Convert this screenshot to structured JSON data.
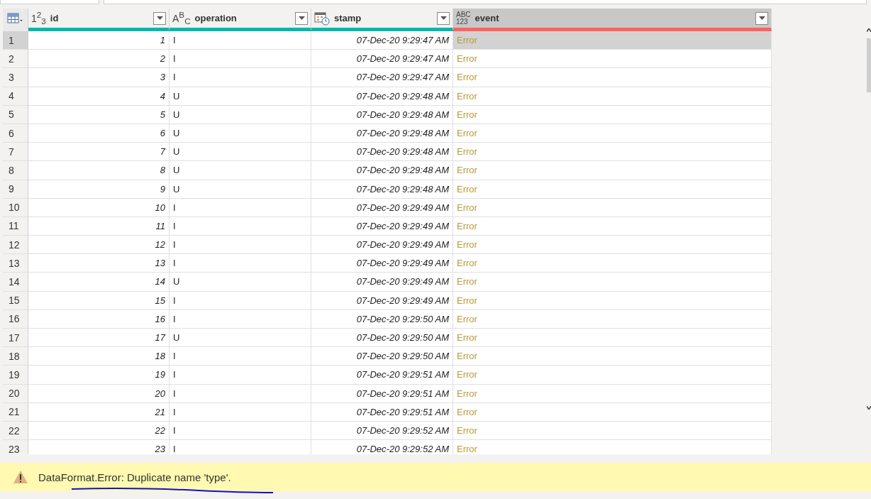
{
  "table": {
    "columns": [
      {
        "name": "id",
        "kind": "number",
        "glyph": [
          "1$^{2}$$_{3}$"
        ],
        "color": "#01b8aa",
        "selected": false
      },
      {
        "name": "operation",
        "kind": "text",
        "glyph": [
          "A$^{B}$$_{C}$"
        ],
        "color": "#01b8aa",
        "selected": false
      },
      {
        "name": "stamp",
        "kind": "datetime",
        "color": "#01b8aa",
        "selected": false
      },
      {
        "name": "event",
        "kind": "any",
        "glyph": [
          "ABC",
          "123"
        ],
        "color": "#fd625e",
        "selected": true
      }
    ],
    "rows": [
      {
        "n": "1",
        "cells": [
          "1",
          "I",
          "07-Dec-20 9:29:47 AM",
          "Error"
        ],
        "selected": true
      },
      {
        "n": "2",
        "cells": [
          "2",
          "I",
          "07-Dec-20 9:29:47 AM",
          "Error"
        ],
        "selected": false
      },
      {
        "n": "3",
        "cells": [
          "3",
          "I",
          "07-Dec-20 9:29:47 AM",
          "Error"
        ],
        "selected": false
      },
      {
        "n": "4",
        "cells": [
          "4",
          "U",
          "07-Dec-20 9:29:48 AM",
          "Error"
        ],
        "selected": false
      },
      {
        "n": "5",
        "cells": [
          "5",
          "U",
          "07-Dec-20 9:29:48 AM",
          "Error"
        ],
        "selected": false
      },
      {
        "n": "6",
        "cells": [
          "6",
          "U",
          "07-Dec-20 9:29:48 AM",
          "Error"
        ],
        "selected": false
      },
      {
        "n": "7",
        "cells": [
          "7",
          "U",
          "07-Dec-20 9:29:48 AM",
          "Error"
        ],
        "selected": false
      },
      {
        "n": "8",
        "cells": [
          "8",
          "U",
          "07-Dec-20 9:29:48 AM",
          "Error"
        ],
        "selected": false
      },
      {
        "n": "9",
        "cells": [
          "9",
          "U",
          "07-Dec-20 9:29:48 AM",
          "Error"
        ],
        "selected": false
      },
      {
        "n": "10",
        "cells": [
          "10",
          "I",
          "07-Dec-20 9:29:49 AM",
          "Error"
        ],
        "selected": false
      },
      {
        "n": "11",
        "cells": [
          "11",
          "I",
          "07-Dec-20 9:29:49 AM",
          "Error"
        ],
        "selected": false
      },
      {
        "n": "12",
        "cells": [
          "12",
          "I",
          "07-Dec-20 9:29:49 AM",
          "Error"
        ],
        "selected": false
      },
      {
        "n": "13",
        "cells": [
          "13",
          "I",
          "07-Dec-20 9:29:49 AM",
          "Error"
        ],
        "selected": false
      },
      {
        "n": "14",
        "cells": [
          "14",
          "U",
          "07-Dec-20 9:29:49 AM",
          "Error"
        ],
        "selected": false
      },
      {
        "n": "15",
        "cells": [
          "15",
          "I",
          "07-Dec-20 9:29:49 AM",
          "Error"
        ],
        "selected": false
      },
      {
        "n": "16",
        "cells": [
          "16",
          "I",
          "07-Dec-20 9:29:50 AM",
          "Error"
        ],
        "selected": false
      },
      {
        "n": "17",
        "cells": [
          "17",
          "U",
          "07-Dec-20 9:29:50 AM",
          "Error"
        ],
        "selected": false
      },
      {
        "n": "18",
        "cells": [
          "18",
          "I",
          "07-Dec-20 9:29:50 AM",
          "Error"
        ],
        "selected": false
      },
      {
        "n": "19",
        "cells": [
          "19",
          "I",
          "07-Dec-20 9:29:51 AM",
          "Error"
        ],
        "selected": false
      },
      {
        "n": "20",
        "cells": [
          "20",
          "I",
          "07-Dec-20 9:29:51 AM",
          "Error"
        ],
        "selected": false
      },
      {
        "n": "21",
        "cells": [
          "21",
          "I",
          "07-Dec-20 9:29:51 AM",
          "Error"
        ],
        "selected": false
      },
      {
        "n": "22",
        "cells": [
          "22",
          "I",
          "07-Dec-20 9:29:52 AM",
          "Error"
        ],
        "selected": false
      },
      {
        "n": "23",
        "cells": [
          "23",
          "I",
          "07-Dec-20 9:29:52 AM",
          "Error"
        ],
        "selected": false
      }
    ]
  },
  "error_bar": {
    "message": "DataFormat.Error: Duplicate name 'type'."
  }
}
